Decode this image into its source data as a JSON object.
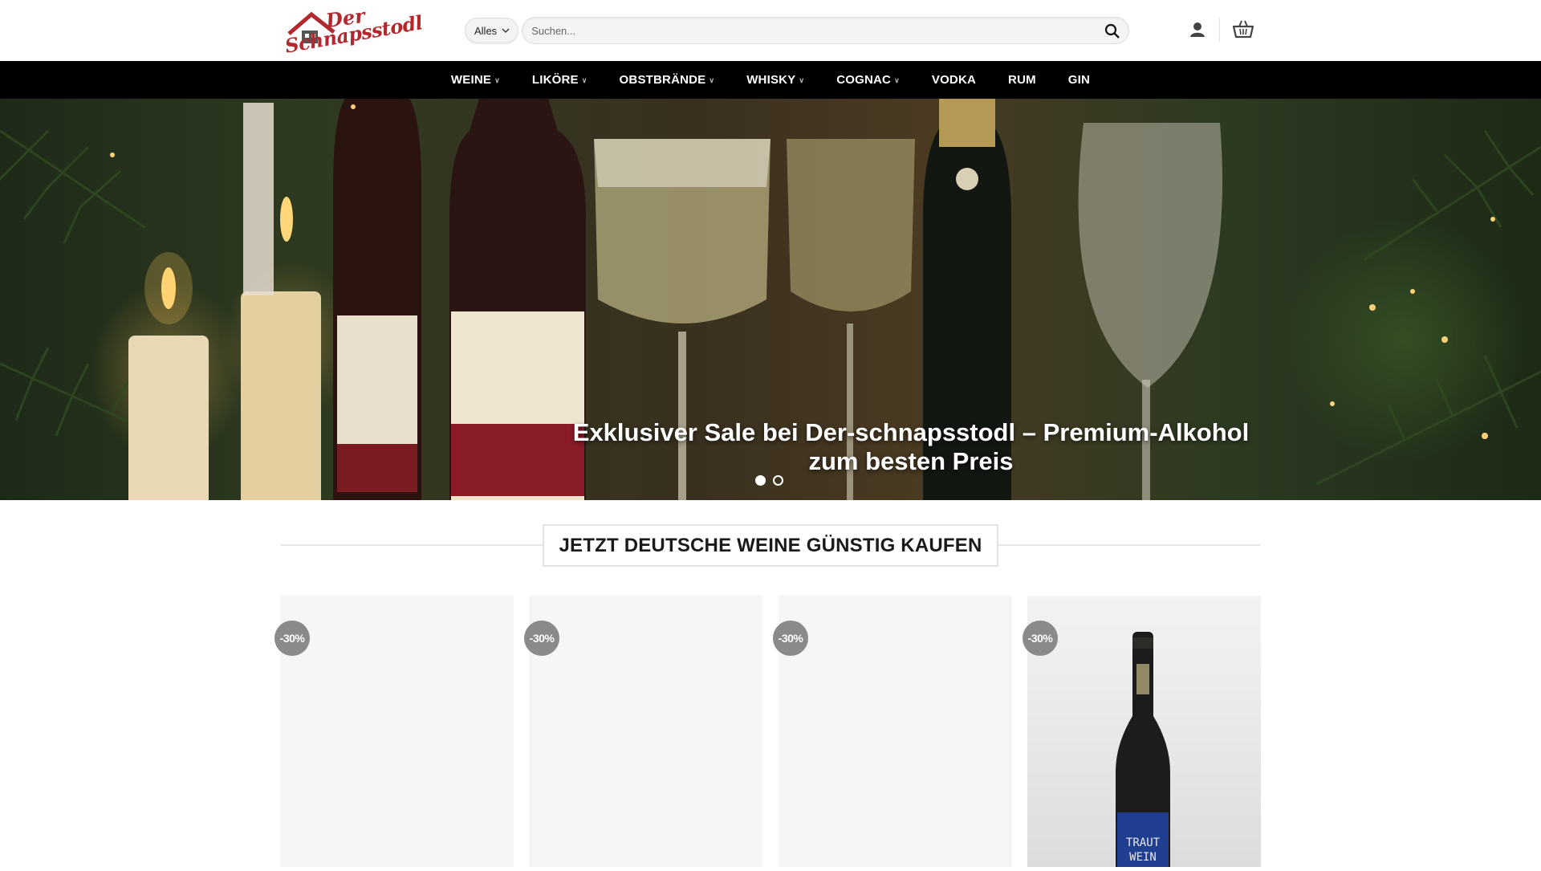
{
  "header": {
    "logo": {
      "line1": "Der",
      "line2": "Schnapsstodl"
    },
    "search": {
      "category": "Alles",
      "placeholder": "Suchen..."
    }
  },
  "nav": {
    "items": [
      {
        "label": "WEINE",
        "dropdown": true
      },
      {
        "label": "LIKÖRE",
        "dropdown": true
      },
      {
        "label": "OBSTBRÄNDE",
        "dropdown": true
      },
      {
        "label": "WHISKY",
        "dropdown": true
      },
      {
        "label": "COGNAC",
        "dropdown": true
      },
      {
        "label": "VODKA",
        "dropdown": false
      },
      {
        "label": "RUM",
        "dropdown": false
      },
      {
        "label": "GIN",
        "dropdown": false
      }
    ]
  },
  "hero": {
    "title": "Exklusiver Sale bei Der-schnapsstodl – Premium-Alkohol zum besten Preis",
    "slides": 2,
    "active_slide": 1
  },
  "section": {
    "title": "JETZT DEUTSCHE WEINE GÜNSTIG KAUFEN"
  },
  "products": [
    {
      "badge": "-30%"
    },
    {
      "badge": "-30%"
    },
    {
      "badge": "-30%"
    },
    {
      "badge": "-30%",
      "label_line1": "TRAUT",
      "label_line2": "WEIN"
    }
  ],
  "colors": {
    "nav_bg": "#000000",
    "logo_red": "#b3282d",
    "badge_gray": "#8a8a8a"
  }
}
